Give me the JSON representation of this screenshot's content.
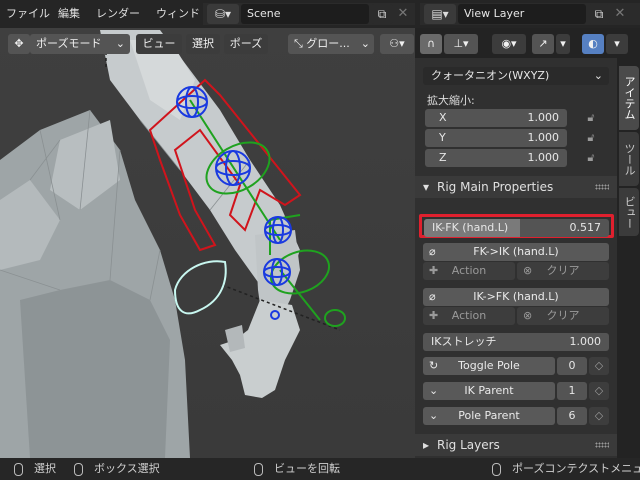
{
  "menubar": {
    "items": [
      "ファイル",
      "編集",
      "レンダー",
      "ウィンド"
    ],
    "scene_name": "Scene",
    "view_layer_name": "View Layer"
  },
  "viewport_header": {
    "mode": "ポーズモード",
    "view": "ビュー",
    "select": "選択",
    "pose": "ポーズ",
    "transform_orientation": "グロー..."
  },
  "panel": {
    "rotation_mode": "クォータニオン(WXYZ)",
    "scale_label": "拡大縮小:",
    "scale": [
      {
        "axis": "X",
        "value": "1.000"
      },
      {
        "axis": "Y",
        "value": "1.000"
      },
      {
        "axis": "Z",
        "value": "1.000"
      }
    ],
    "rig_main_title": "Rig Main Properties",
    "ikfk_label": "IK-FK (hand.L)",
    "ikfk_value": "0.517",
    "ikfk_fraction": 0.517,
    "fk_ik_label": "FK->IK (hand.L)",
    "action1": "Action",
    "clear1": "クリア",
    "ik_fk_label": "IK->FK (hand.L)",
    "action2": "Action",
    "clear2": "クリア",
    "ik_stretch_label": "IKストレッチ",
    "ik_stretch_value": "1.000",
    "toggle_pole_label": "Toggle Pole",
    "toggle_pole_value": "0",
    "ik_parent_label": "IK Parent",
    "ik_parent_value": "1",
    "pole_parent_label": "Pole Parent",
    "pole_parent_value": "6",
    "rig_layers_title": "Rig Layers"
  },
  "tabs": [
    "アイテム",
    "ツール",
    "ビュー"
  ],
  "statusbar": {
    "select": "選択",
    "box_select": "ボックス選択",
    "rotate_view": "ビューを回転",
    "pose_context": "ポーズコンテクストメニュー"
  },
  "colors": {
    "highlight_border": "#e0202e",
    "rig_red": "#d0141c",
    "rig_green": "#1fa21f",
    "rig_blue": "#1a3ae0",
    "rig_cyan": "#c8f7f0"
  }
}
